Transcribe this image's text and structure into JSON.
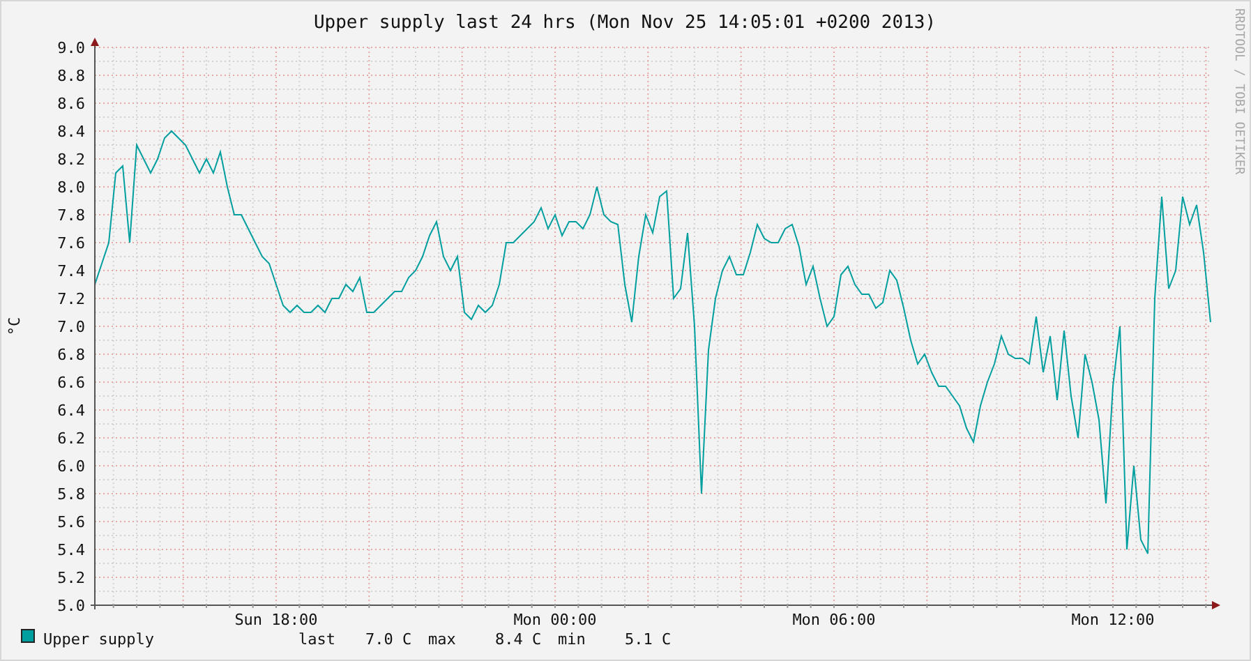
{
  "graph": {
    "chart_data": {
      "type": "line",
      "title": "Upper supply last 24 hrs (Mon Nov 25 14:05:01 +0200 2013)",
      "ylabel": "°C",
      "categories": [
        null,
        null,
        null,
        null,
        null,
        null,
        null,
        null,
        null,
        null,
        null,
        null,
        null,
        null,
        null,
        null,
        null,
        null,
        null,
        null,
        null,
        null,
        null,
        null,
        null,
        null,
        "Sun 18:00",
        null,
        null,
        null,
        null,
        null,
        null,
        null,
        null,
        null,
        null,
        null,
        null,
        null,
        null,
        null,
        null,
        null,
        null,
        null,
        null,
        null,
        null,
        null,
        null,
        null,
        null,
        null,
        null,
        null,
        null,
        null,
        null,
        null,
        null,
        null,
        null,
        null,
        null,
        null,
        "Mon 00:00",
        null,
        null,
        null,
        null,
        null,
        null,
        null,
        null,
        null,
        null,
        null,
        null,
        null,
        null,
        null,
        null,
        null,
        null,
        null,
        null,
        null,
        null,
        null,
        null,
        null,
        null,
        null,
        null,
        null,
        null,
        null,
        null,
        null,
        null,
        null,
        null,
        null,
        null,
        null,
        "Mon 06:00",
        null,
        null,
        null,
        null,
        null,
        null,
        null,
        null,
        null,
        null,
        null,
        null,
        null,
        null,
        null,
        null,
        null,
        null,
        null,
        null,
        null,
        null,
        null,
        null,
        null,
        null,
        null,
        null,
        null,
        null,
        null,
        null,
        null,
        null,
        null,
        null,
        null,
        null,
        null,
        "Mon 12:00",
        null,
        null,
        null,
        null,
        null,
        null,
        null,
        null,
        null,
        null,
        null,
        null,
        null,
        null
      ],
      "series": [
        {
          "name": "Upper supply",
          "color": "#009f9f",
          "values": [
            7.3,
            7.45,
            7.6,
            8.1,
            8.15,
            7.6,
            8.3,
            8.2,
            8.1,
            8.2,
            8.35,
            8.4,
            8.35,
            8.3,
            8.2,
            8.1,
            8.2,
            8.1,
            8.25,
            8.0,
            7.8,
            7.8,
            7.7,
            7.6,
            7.5,
            7.45,
            7.3,
            7.15,
            7.1,
            7.15,
            7.1,
            7.1,
            7.15,
            7.1,
            7.2,
            7.2,
            7.3,
            7.25,
            7.35,
            7.1,
            7.1,
            7.15,
            7.2,
            7.25,
            7.25,
            7.35,
            7.4,
            7.5,
            7.65,
            7.75,
            7.5,
            7.4,
            7.5,
            7.1,
            7.05,
            7.15,
            7.1,
            7.15,
            7.3,
            7.6,
            7.6,
            7.65,
            7.7,
            7.75,
            7.85,
            7.7,
            7.8,
            7.65,
            7.75,
            7.75,
            7.7,
            7.8,
            8.0,
            7.8,
            7.75,
            7.73,
            7.3,
            7.03,
            7.5,
            7.8,
            7.67,
            7.93,
            7.97,
            7.2,
            7.27,
            7.67,
            7.0,
            5.8,
            6.83,
            7.2,
            7.4,
            7.5,
            7.37,
            7.37,
            7.53,
            7.73,
            7.63,
            7.6,
            7.6,
            7.7,
            7.73,
            7.57,
            7.3,
            7.43,
            7.2,
            7.0,
            7.07,
            7.37,
            7.43,
            7.3,
            7.23,
            7.23,
            7.13,
            7.17,
            7.4,
            7.33,
            7.13,
            6.9,
            6.73,
            6.8,
            6.67,
            6.57,
            6.57,
            6.5,
            6.43,
            6.27,
            6.17,
            6.43,
            6.6,
            6.73,
            6.93,
            6.8,
            6.77,
            6.77,
            6.73,
            7.07,
            6.67,
            6.93,
            6.47,
            6.97,
            6.5,
            6.2,
            6.8,
            6.6,
            6.33,
            5.73,
            6.57,
            7.0,
            5.4,
            6.0,
            5.47,
            5.37,
            7.2,
            7.93,
            7.27,
            7.4,
            7.93,
            7.73,
            7.87,
            7.53,
            7.03
          ]
        }
      ],
      "ylim": [
        5,
        9
      ],
      "grid": true,
      "yticks": [
        {
          "value": 5,
          "label": "5.0"
        },
        {
          "value": 5.2,
          "label": "5.2"
        },
        {
          "value": 5.4,
          "label": "5.4"
        },
        {
          "value": 5.6,
          "label": "5.6"
        },
        {
          "value": 5.8,
          "label": "5.8"
        },
        {
          "value": 6,
          "label": "6.0"
        },
        {
          "value": 6.2,
          "label": "6.2"
        },
        {
          "value": 6.4,
          "label": "6.4"
        },
        {
          "value": 6.6,
          "label": "6.6"
        },
        {
          "value": 6.8,
          "label": "6.8"
        },
        {
          "value": 7,
          "label": "7.0"
        },
        {
          "value": 7.2,
          "label": "7.2"
        },
        {
          "value": 7.4,
          "label": "7.4"
        },
        {
          "value": 7.6,
          "label": "7.6"
        },
        {
          "value": 7.8,
          "label": "7.8"
        },
        {
          "value": 8,
          "label": "8.0"
        },
        {
          "value": 8.2,
          "label": "8.2"
        },
        {
          "value": 8.4,
          "label": "8.4"
        },
        {
          "value": 8.6,
          "label": "8.6"
        },
        {
          "value": 8.8,
          "label": "8.8"
        },
        {
          "value": 9,
          "label": "9.0"
        }
      ]
    },
    "credit": "RRDTOOL / TOBI OETIKER",
    "legend_stats": [
      {
        "label": "last",
        "value": "7.0 C"
      },
      {
        "label": "max",
        "value": "8.4 C"
      },
      {
        "label": "min",
        "value": "5.1 C"
      }
    ]
  }
}
